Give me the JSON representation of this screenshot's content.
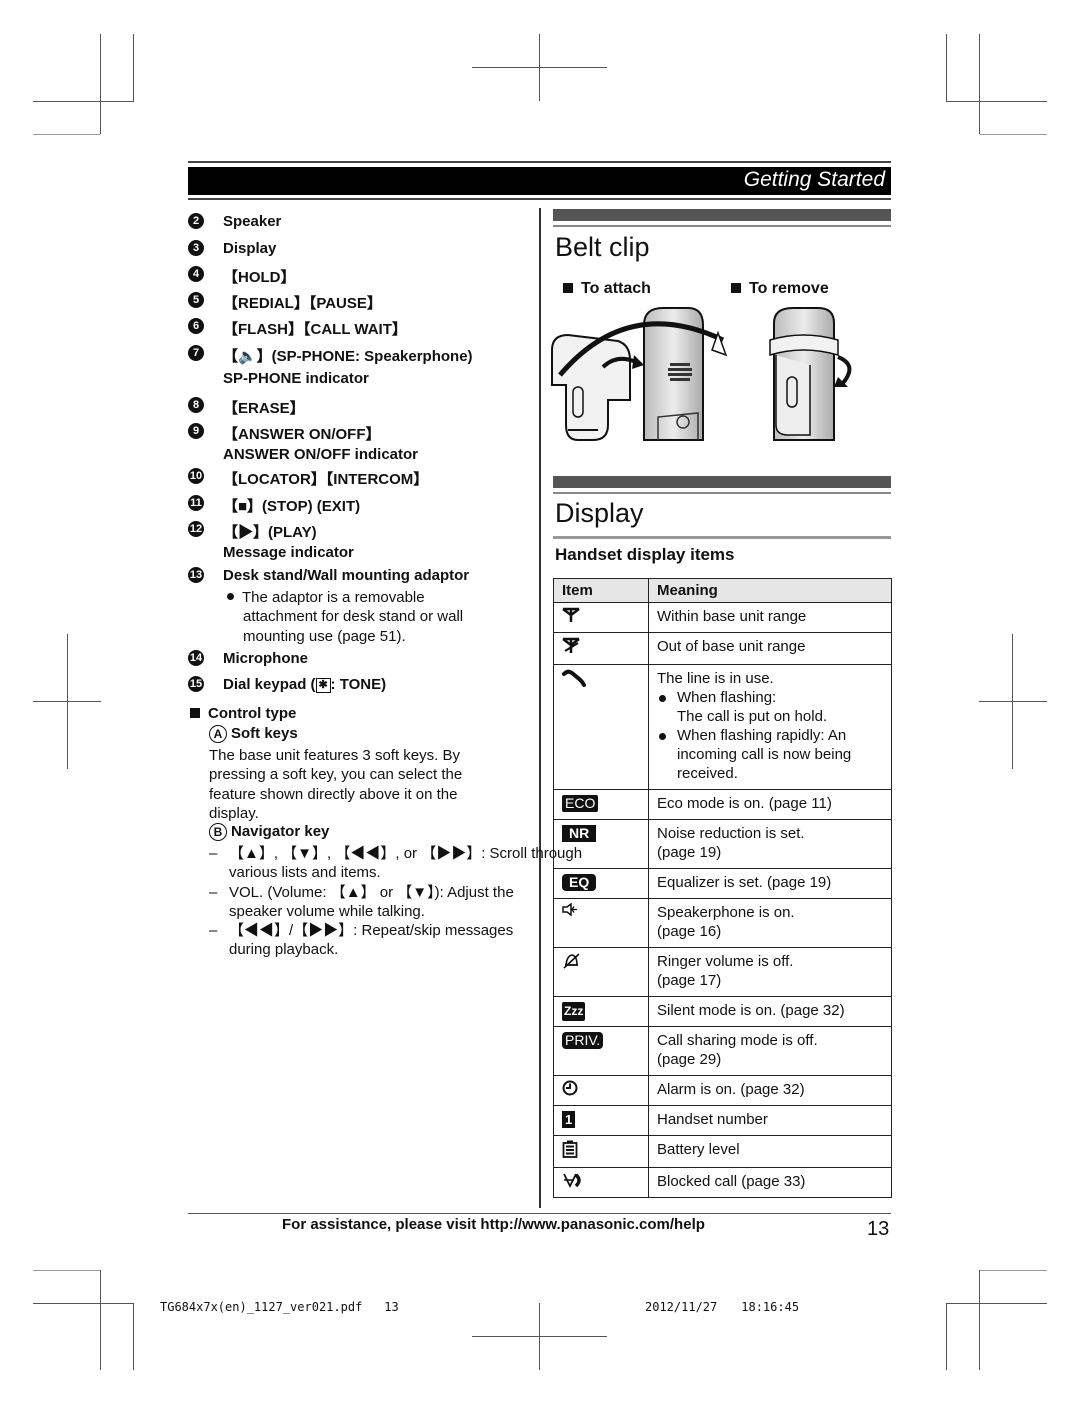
{
  "header": {
    "section_title": "Getting Started"
  },
  "left_column": {
    "items": [
      {
        "num": "2",
        "text": "Speaker"
      },
      {
        "num": "3",
        "text": "Display"
      },
      {
        "num": "4",
        "text": "【HOLD】"
      },
      {
        "num": "5",
        "text": "【REDIAL】【PAUSE】"
      },
      {
        "num": "6",
        "text": "【FLASH】【CALL WAIT】"
      },
      {
        "num": "7",
        "text": "【🔈】(SP-PHONE: Speakerphone)",
        "sub": "SP-PHONE indicator"
      },
      {
        "num": "8",
        "text": "【ERASE】"
      },
      {
        "num": "9",
        "text": "【ANSWER ON/OFF】",
        "sub": "ANSWER ON/OFF indicator"
      },
      {
        "num": "10",
        "text": "【LOCATOR】【INTERCOM】"
      },
      {
        "num": "11",
        "text": "【■】(STOP) (EXIT)"
      },
      {
        "num": "12",
        "text": "【▶】(PLAY)",
        "sub": "Message indicator"
      },
      {
        "num": "13",
        "text": "Desk stand/Wall mounting adaptor"
      },
      {
        "num": "14",
        "text": "Microphone"
      },
      {
        "num": "15",
        "text": "Dial keypad (",
        "key": "✱",
        "text_after": ": TONE)"
      }
    ],
    "adaptor_note": [
      "The adaptor is a removable",
      "attachment for desk stand or wall",
      "mounting use (page 51)."
    ],
    "control_type": {
      "heading": "Control type",
      "soft_keys": {
        "letter": "A",
        "label": "Soft keys",
        "desc": [
          "The base unit features 3 soft keys. By",
          "pressing a soft key, you can select the",
          "feature shown directly above it on the",
          "display."
        ]
      },
      "navigator": {
        "letter": "B",
        "label": "Navigator key",
        "dashes": [
          [
            "【▲】, 【▼】, 【◀◀】, or 【▶▶】: Scroll through",
            "various lists and items."
          ],
          [
            "VOL. (Volume: 【▲】 or 【▼】): Adjust the",
            "speaker volume while talking."
          ],
          [
            "【◀◀】/【▶▶】: Repeat/skip messages",
            "during playback."
          ]
        ]
      }
    }
  },
  "belt_clip": {
    "title": "Belt clip",
    "attach_label": "To attach",
    "remove_label": "To remove"
  },
  "display": {
    "title": "Display",
    "subtitle": "Handset display items",
    "table": {
      "headers": [
        "Item",
        "Meaning"
      ],
      "rows": [
        {
          "icon": "antenna-icon",
          "meaning": [
            "Within base unit range"
          ]
        },
        {
          "icon": "antenna-out-icon",
          "meaning": [
            "Out of base unit range"
          ]
        },
        {
          "icon": "phone-handset-icon",
          "meaning": [
            "The line is in use."
          ],
          "bullets": [
            [
              "When flashing:",
              "The call is put on hold."
            ],
            [
              "When flashing rapidly: An",
              "incoming call is now being",
              "received."
            ]
          ]
        },
        {
          "icon": "eco-icon",
          "icon_text": "ECO",
          "meaning": [
            "Eco mode is on. (page 11)"
          ]
        },
        {
          "icon": "nr-icon",
          "icon_text": "NR",
          "meaning": [
            "Noise reduction is set.",
            "(page 19)"
          ]
        },
        {
          "icon": "eq-icon",
          "icon_text": "EQ",
          "meaning": [
            "Equalizer is set. (page 19)"
          ]
        },
        {
          "icon": "speakerphone-icon",
          "meaning": [
            "Speakerphone is on.",
            "(page 16)"
          ]
        },
        {
          "icon": "ringer-off-icon",
          "meaning": [
            "Ringer volume is off.",
            "(page 17)"
          ]
        },
        {
          "icon": "silent-mode-icon",
          "icon_text": "Zzz",
          "meaning": [
            "Silent mode is on. (page 32)"
          ]
        },
        {
          "icon": "priv-icon",
          "icon_text": "PRIV.",
          "meaning": [
            "Call sharing mode is off.",
            "(page 29)"
          ]
        },
        {
          "icon": "alarm-icon",
          "meaning": [
            "Alarm is on. (page 32)"
          ]
        },
        {
          "icon": "handset-number-icon",
          "icon_text": "1",
          "meaning": [
            "Handset number"
          ]
        },
        {
          "icon": "battery-icon",
          "meaning": [
            "Battery level"
          ]
        },
        {
          "icon": "blocked-call-icon",
          "meaning": [
            "Blocked call (page 33)"
          ]
        }
      ]
    }
  },
  "footer": {
    "assistance": "For assistance, please visit http://www.panasonic.com/help",
    "page_number": "13"
  },
  "print_info": {
    "file": "TG684x7x(en)_1127_ver021.pdf",
    "page": "13",
    "date": "2012/11/27",
    "time": "18:16:45"
  }
}
